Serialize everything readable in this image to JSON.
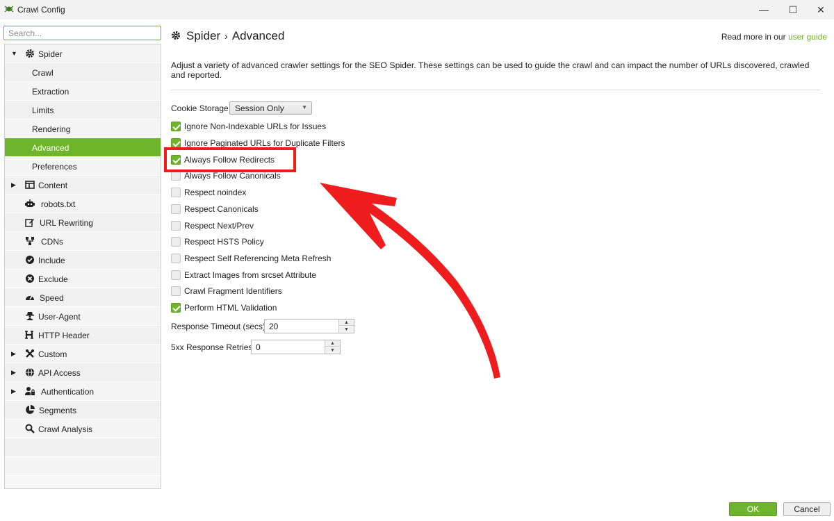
{
  "window": {
    "title": "Crawl Config",
    "minimize": "—",
    "maximize": "☐",
    "close": "✕"
  },
  "search": {
    "placeholder": "Search..."
  },
  "sidebar": {
    "items": [
      {
        "label": "Spider"
      },
      {
        "label": "Crawl"
      },
      {
        "label": "Extraction"
      },
      {
        "label": "Limits"
      },
      {
        "label": "Rendering"
      },
      {
        "label": "Advanced"
      },
      {
        "label": "Preferences"
      },
      {
        "label": "Content"
      },
      {
        "label": "robots.txt"
      },
      {
        "label": "URL Rewriting"
      },
      {
        "label": "CDNs"
      },
      {
        "label": "Include"
      },
      {
        "label": "Exclude"
      },
      {
        "label": "Speed"
      },
      {
        "label": "User-Agent"
      },
      {
        "label": "HTTP Header"
      },
      {
        "label": "Custom"
      },
      {
        "label": "API Access"
      },
      {
        "label": "Authentication"
      },
      {
        "label": "Segments"
      },
      {
        "label": "Crawl Analysis"
      }
    ]
  },
  "header": {
    "breadcrumb_root": "Spider",
    "breadcrumb_sep": "›",
    "breadcrumb_current": "Advanced",
    "readmore_prefix": "Read more in our",
    "readmore_link": "user guide"
  },
  "description": "Adjust a variety of advanced crawler settings for the SEO Spider. These settings can be used to guide the crawl and can impact the number of URLs discovered, crawled and reported.",
  "cookie": {
    "label": "Cookie Storage",
    "value": "Session Only"
  },
  "options": [
    {
      "label": "Ignore Non-Indexable URLs for Issues",
      "checked": true
    },
    {
      "label": "Ignore Paginated URLs for Duplicate Filters",
      "checked": true
    },
    {
      "label": "Always Follow Redirects",
      "checked": true
    },
    {
      "label": "Always Follow Canonicals",
      "checked": false
    },
    {
      "label": "Respect noindex",
      "checked": false
    },
    {
      "label": "Respect Canonicals",
      "checked": false
    },
    {
      "label": "Respect Next/Prev",
      "checked": false
    },
    {
      "label": "Respect HSTS Policy",
      "checked": false
    },
    {
      "label": "Respect Self Referencing Meta Refresh",
      "checked": false
    },
    {
      "label": "Extract Images from srcset Attribute",
      "checked": false
    },
    {
      "label": "Crawl Fragment Identifiers",
      "checked": false
    },
    {
      "label": "Perform HTML Validation",
      "checked": true
    }
  ],
  "timeout": {
    "label": "Response Timeout (secs)",
    "value": "20"
  },
  "retries": {
    "label": "5xx Response Retries",
    "value": "0"
  },
  "buttons": {
    "ok": "OK",
    "cancel": "Cancel"
  },
  "colors": {
    "accent": "#6fb52c",
    "annotation": "#ee1c1c"
  }
}
